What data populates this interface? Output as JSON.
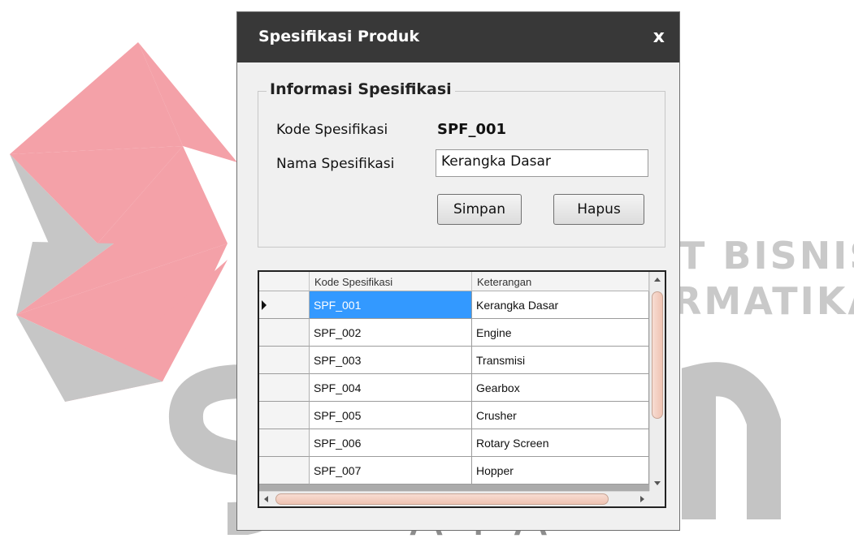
{
  "watermark": {
    "line1": "T BISNIS",
    "line2": "RMATIKA",
    "line3": "AYA"
  },
  "window": {
    "title": "Spesifikasi Produk",
    "close_label": "x"
  },
  "form": {
    "group_title": "Informasi Spesifikasi",
    "kode_label": "Kode Spesifikasi",
    "kode_value": "SPF_001",
    "nama_label": "Nama Spesifikasi",
    "nama_value": "Kerangka Dasar",
    "save_label": "Simpan",
    "delete_label": "Hapus"
  },
  "grid": {
    "columns": [
      "Kode Spesifikasi",
      "Keterangan"
    ],
    "rows": [
      {
        "kode": "SPF_001",
        "keterangan": "Kerangka Dasar"
      },
      {
        "kode": "SPF_002",
        "keterangan": "Engine"
      },
      {
        "kode": "SPF_003",
        "keterangan": "Transmisi"
      },
      {
        "kode": "SPF_004",
        "keterangan": "Gearbox"
      },
      {
        "kode": "SPF_005",
        "keterangan": "Crusher"
      },
      {
        "kode": "SPF_006",
        "keterangan": "Rotary Screen"
      },
      {
        "kode": "SPF_007",
        "keterangan": "Hopper"
      }
    ]
  },
  "colors": {
    "titlebar": "#383838",
    "selection": "#3399ff",
    "watermark_red": "#f4a1a8",
    "watermark_gray": "#c9c9c9"
  }
}
